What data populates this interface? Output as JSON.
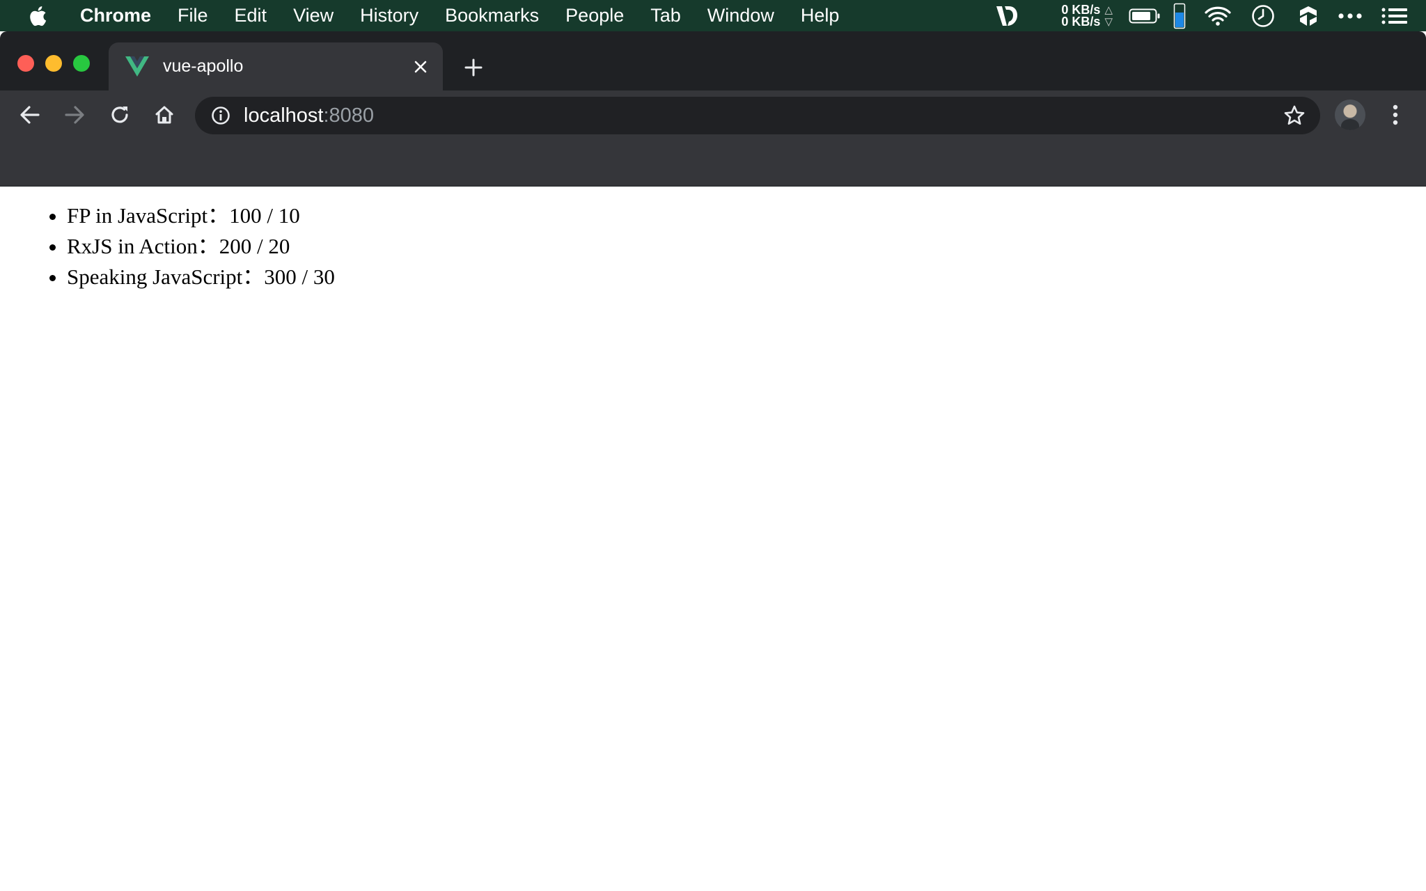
{
  "menubar": {
    "app_name": "Chrome",
    "items": [
      "File",
      "Edit",
      "View",
      "History",
      "Bookmarks",
      "People",
      "Tab",
      "Window",
      "Help"
    ],
    "net_upload": "0 KB/s",
    "net_download": "0 KB/s",
    "icons": [
      "apple-icon",
      "vectorize-icon",
      "network-speed-icon",
      "battery-icon",
      "wifi-icon",
      "clock-icon",
      "cube-icon",
      "more-icon",
      "list-icon"
    ]
  },
  "browser": {
    "tab": {
      "title": "vue-apollo",
      "favicon": "vue-logo-icon"
    },
    "omnibox": {
      "host": "localhost",
      "port": ":8080"
    },
    "colors": {
      "menubar": "#163a2c",
      "tabstrip": "#1f2124",
      "toolbar": "#35363a",
      "omnibox": "#202124",
      "vue_green": "#41b883",
      "vue_dark": "#35495e"
    }
  },
  "page": {
    "books": [
      {
        "label": "FP in JavaScript：100 / 10"
      },
      {
        "label": "RxJS in Action：200 / 20"
      },
      {
        "label": "Speaking JavaScript：300 / 30"
      }
    ]
  }
}
